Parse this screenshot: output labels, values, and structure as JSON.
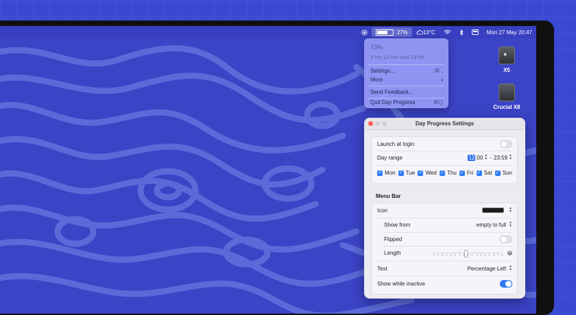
{
  "menubar": {
    "battery_percent": "27%",
    "battery_level": 0.73,
    "weather": "13°C",
    "datetime": "Mon 27 May  20:47",
    "icons": [
      "record-icon",
      "battery-icon",
      "cloud-icon",
      "wifi-icon",
      "bluetooth-icon",
      "control-center-icon"
    ]
  },
  "desktop": {
    "items": [
      {
        "label": "X5"
      },
      {
        "label": "Crucial X8"
      }
    ]
  },
  "dropdown": {
    "percent": "73%",
    "remaining": "3 hrs 12 min until 23:59",
    "settings_label": "Settings...",
    "settings_shortcut": "⌘ ,",
    "more_label": "More",
    "more_chevron": "›",
    "feedback_label": "Send Feedback...",
    "quit_label": "Quit Day Progress",
    "quit_shortcut": "⌘Q"
  },
  "settings": {
    "window_title": "Day Progress Settings",
    "launch_label": "Launch at login",
    "launch_on": false,
    "day_range_label": "Day range",
    "start_hour": "12",
    "start_min": ":00",
    "range_sep": "-",
    "end_time": "23:59",
    "days": [
      {
        "label": "Mon",
        "checked": true
      },
      {
        "label": "Tue",
        "checked": true
      },
      {
        "label": "Wed",
        "checked": true
      },
      {
        "label": "Thu",
        "checked": true
      },
      {
        "label": "Fri",
        "checked": true
      },
      {
        "label": "Sat",
        "checked": true
      },
      {
        "label": "Sun",
        "checked": true
      }
    ],
    "menu_bar_title": "Menu Bar",
    "icon_label": "Icon",
    "show_from_label": "Show from",
    "show_from_value": "empty to full",
    "flipped_label": "Flipped",
    "flipped_on": false,
    "length_label": "Length",
    "length_value": 0.47,
    "text_label": "Text",
    "text_value": "Percentage Left",
    "inactive_label": "Show while inactive",
    "inactive_on": true
  },
  "colors": {
    "accent": "#2f7bf6",
    "wallpaper": "#3b43c6",
    "wave": "#5b6ad8"
  }
}
